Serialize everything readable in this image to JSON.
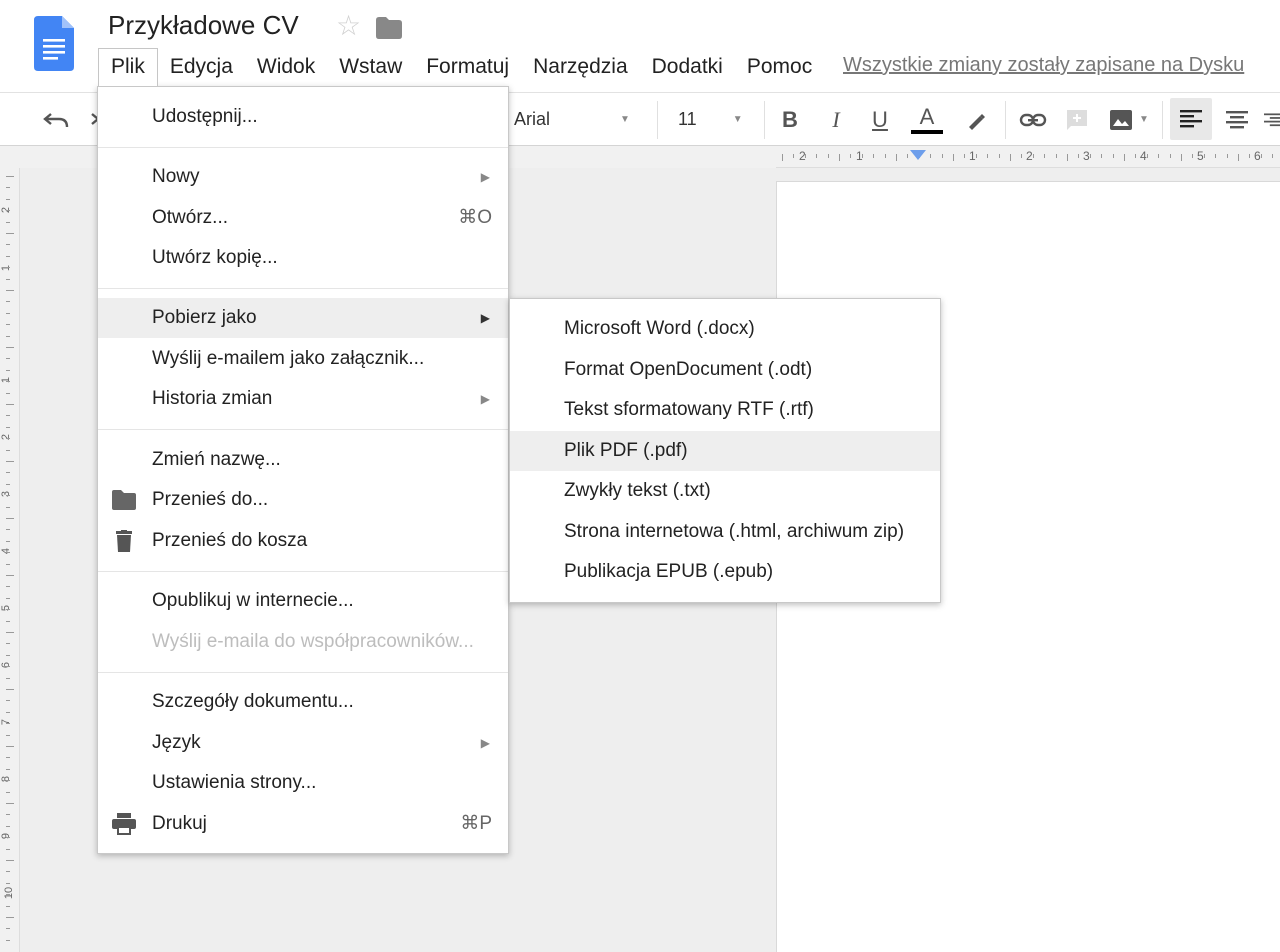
{
  "app": {
    "title": "Przykładowe CV",
    "save_status": "Wszystkie zmiany zostały zapisane na Dysku",
    "icons": {
      "doc": "google-docs-icon",
      "star": "star-icon",
      "folder": "folder-icon"
    },
    "colors": {
      "doc_icon": "#4285f4",
      "highlight": "#eeeeee",
      "accent": "#6d9eeb"
    }
  },
  "menubar": [
    "Plik",
    "Edycja",
    "Widok",
    "Wstaw",
    "Formatuj",
    "Narzędzia",
    "Dodatki",
    "Pomoc"
  ],
  "toolbar": {
    "font": "Arial",
    "size": "11",
    "bold": "B",
    "italic": "I",
    "underline": "U",
    "text_color": "A"
  },
  "ruler": {
    "labels": [
      "2",
      "1",
      "1",
      "2",
      "3",
      "4",
      "5",
      "6"
    ],
    "vlabels": [
      "2",
      "1",
      "1",
      "2",
      "3",
      "4",
      "5",
      "6",
      "7",
      "8",
      "9",
      "10"
    ]
  },
  "file_menu": {
    "items": [
      {
        "label": "Udostępnij..."
      },
      {
        "label": "Nowy",
        "submenu": true
      },
      {
        "label": "Otwórz...",
        "shortcut": "⌘O"
      },
      {
        "label": "Utwórz kopię..."
      },
      {
        "label": "Pobierz jako",
        "submenu": true,
        "highlighted": true
      },
      {
        "label": "Wyślij e-mailem jako załącznik..."
      },
      {
        "label": "Historia zmian",
        "submenu": true
      },
      {
        "label": "Zmień nazwę..."
      },
      {
        "label": "Przenieś do...",
        "icon": "folder-icon"
      },
      {
        "label": "Przenieś do kosza",
        "icon": "trash-icon"
      },
      {
        "label": "Opublikuj w internecie..."
      },
      {
        "label": "Wyślij e-maila do współpracowników...",
        "disabled": true
      },
      {
        "label": "Szczegóły dokumentu..."
      },
      {
        "label": "Język",
        "submenu": true
      },
      {
        "label": "Ustawienia strony..."
      },
      {
        "label": "Drukuj",
        "icon": "printer-icon",
        "shortcut": "⌘P"
      }
    ]
  },
  "download_submenu": {
    "items": [
      {
        "label": "Microsoft Word (.docx)"
      },
      {
        "label": "Format OpenDocument (.odt)"
      },
      {
        "label": "Tekst sformatowany RTF (.rtf)"
      },
      {
        "label": "Plik PDF (.pdf)",
        "highlighted": true
      },
      {
        "label": "Zwykły tekst (.txt)"
      },
      {
        "label": "Strona internetowa (.html, archiwum zip)"
      },
      {
        "label": "Publikacja EPUB (.epub)"
      }
    ]
  }
}
